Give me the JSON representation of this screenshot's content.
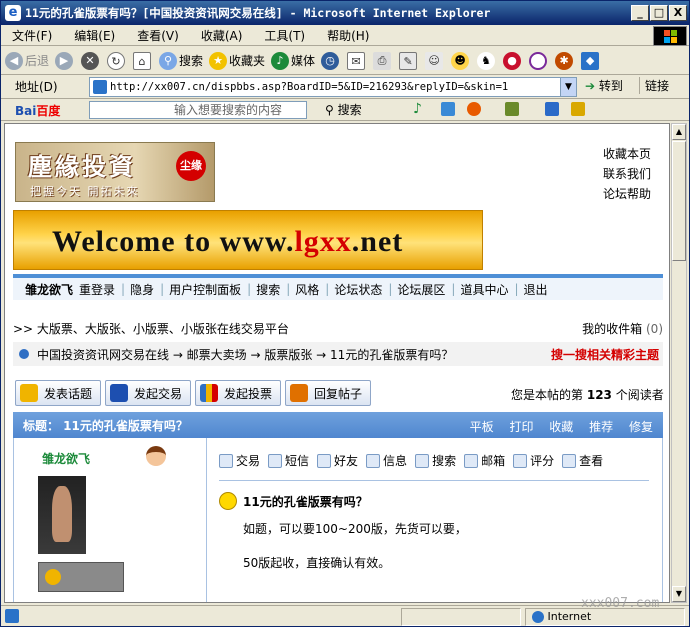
{
  "window": {
    "title": "11元的孔雀版票有吗？[中国投资资讯网交易在线] - Microsoft Internet Explorer",
    "minimize": "_",
    "maximize": "□",
    "close": "X"
  },
  "menu": [
    "文件(F)",
    "编辑(E)",
    "查看(V)",
    "收藏(A)",
    "工具(T)",
    "帮助(H)"
  ],
  "toolbar": {
    "back": "后退",
    "search": "搜索",
    "favorites": "收藏夹",
    "media": "媒体"
  },
  "address": {
    "label": "地址(D)",
    "url": "http://xx007.cn/dispbbs.asp?BoardID=5&ID=216293&replyID=&skin=1",
    "go": "转到",
    "links": "链接"
  },
  "baidu": {
    "logo_bai": "Bai",
    "logo_du": "百度",
    "placeholder": "输入想要搜索的内容",
    "search": "搜索"
  },
  "site": {
    "logo_title": "塵緣投資",
    "logo_slogan": "把握今天 開拓未來",
    "logo_seal": "尘缘",
    "top_links": [
      "收藏本页",
      "联系我们",
      "论坛帮助"
    ],
    "banner_prefix": "Welcome to www.",
    "banner_brand": "lgxx",
    "banner_suffix": ".net"
  },
  "userbar": {
    "username": "雏龙欲飞",
    "links": [
      "重登录",
      "隐身",
      "用户控制面板",
      "搜索",
      "风格",
      "论坛状态",
      "论坛展区",
      "道具中心",
      "退出"
    ]
  },
  "crumbs": {
    "tagline": ">> 大版票、大版张、小版票、小版张在线交易平台",
    "inbox": "我的收件箱",
    "inbox_count": "(0)",
    "path": "中国投资资讯网交易在线 → 邮票大卖场 → 版票版张 → 11元的孔雀版票有吗？",
    "hot": "搜一搜相关精彩主题"
  },
  "actions": [
    "发表话题",
    "发起交易",
    "发起投票",
    "回复帖子"
  ],
  "readers": {
    "prefix": "您是本帖的第",
    "count": "123",
    "suffix": "个阅读者"
  },
  "thread": {
    "title": "标题： 11元的孔雀版票有吗？",
    "tools": [
      "平板",
      "打印",
      "收藏",
      "推荐",
      "修复"
    ]
  },
  "post": {
    "author": "雏龙欲飞",
    "tools": [
      "交易",
      "短信",
      "好友",
      "信息",
      "搜索",
      "邮箱",
      "评分",
      "查看"
    ],
    "title": "11元的孔雀版票有吗？",
    "body1": "如题，可以要100~200版，先货可以要，",
    "body2": "50版起收，直接确认有效。"
  },
  "status": {
    "zone": "Internet",
    "watermark": "xxx007.com"
  },
  "colors": {
    "title_bar": "#0a246a",
    "accent_blue": "#4f86cf",
    "hot_red": "#d40000"
  }
}
